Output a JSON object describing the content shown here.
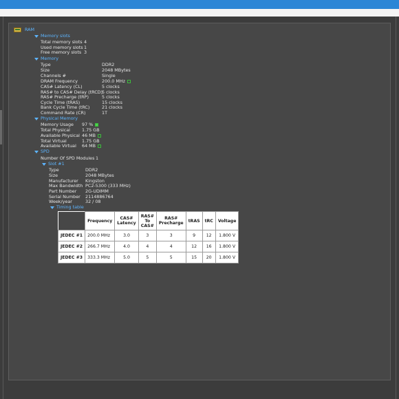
{
  "tree": {
    "root_label": "RAM",
    "memory_slots": {
      "label": "Memory slots",
      "rows": [
        {
          "label": "Total memory slots",
          "value": "4"
        },
        {
          "label": "Used memory slots",
          "value": "1"
        },
        {
          "label": "Free memory slots",
          "value": "3"
        }
      ]
    },
    "memory": {
      "label": "Memory",
      "rows": [
        {
          "label": "Type",
          "value": "DDR2"
        },
        {
          "label": "Size",
          "value": "2048 MBytes"
        },
        {
          "label": "Channels #",
          "value": "Single"
        },
        {
          "label": "DRAM Frequency",
          "value": "200.0 MHz"
        },
        {
          "label": "CAS# Latency (CL)",
          "value": "5 clocks"
        },
        {
          "label": "RAS# to CAS# Delay (tRCD)",
          "value": "5 clocks"
        },
        {
          "label": "RAS# Precharge (tRP)",
          "value": "5 clocks"
        },
        {
          "label": "Cycle Time (tRAS)",
          "value": "15 clocks"
        },
        {
          "label": "Bank Cycle Time (tRC)",
          "value": "21 clocks"
        },
        {
          "label": "Command Rate (CR)",
          "value": "1T"
        }
      ]
    },
    "physical_memory": {
      "label": "Physical Memory",
      "rows": [
        {
          "label": "Memory Usage",
          "value": "97 %"
        },
        {
          "label": "Total Physical",
          "value": "1.75 GB"
        },
        {
          "label": "Available Physical",
          "value": "46 MB"
        },
        {
          "label": "Total Virtual",
          "value": "1.75 GB"
        },
        {
          "label": "Available Virtual",
          "value": "64 MB"
        }
      ]
    },
    "spd": {
      "label": "SPD",
      "modules_label": "Number Of SPD Modules",
      "modules_value": "1",
      "slot": {
        "label": "Slot #1",
        "rows": [
          {
            "label": "Type",
            "value": "DDR2"
          },
          {
            "label": "Size",
            "value": "2048 MBytes"
          },
          {
            "label": "Manufacturer",
            "value": "Kingston"
          },
          {
            "label": "Max Bandwidth",
            "value": "PC2-5300 (333 MHz)"
          },
          {
            "label": "Part Number",
            "value": "2G-UDIMM"
          },
          {
            "label": "Serial Number",
            "value": "2114886764"
          },
          {
            "label": "Week/year",
            "value": "32 / 08"
          }
        ],
        "timing_table": {
          "label": "Timing table",
          "headers": [
            "Frequency",
            "CAS# Latency",
            "RAS# To CAS#",
            "RAS# Precharge",
            "tRAS",
            "tRC",
            "Voltage"
          ],
          "rows": [
            {
              "name": "JEDEC #1",
              "cells": [
                "200.0 MHz",
                "3.0",
                "3",
                "3",
                "9",
                "12",
                "1.800 V"
              ]
            },
            {
              "name": "JEDEC #2",
              "cells": [
                "266.7 MHz",
                "4.0",
                "4",
                "4",
                "12",
                "16",
                "1.800 V"
              ]
            },
            {
              "name": "JEDEC #3",
              "cells": [
                "333.3 MHz",
                "5.0",
                "5",
                "5",
                "15",
                "20",
                "1.800 V"
              ]
            }
          ]
        }
      }
    }
  },
  "indicators": {
    "dram_frequency": "off",
    "memory_usage": "on",
    "available_physical": "off",
    "available_virtual": "off"
  },
  "colors": {
    "title_bar": "#2c86d6",
    "node_text": "#5db5ff",
    "indicator": "#4cd24c"
  }
}
